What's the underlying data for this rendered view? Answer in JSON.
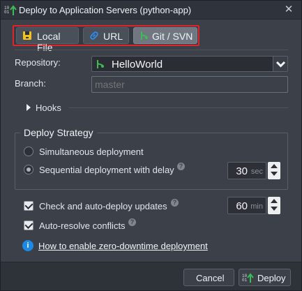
{
  "window": {
    "title": "Deploy to Application Servers (python-app)",
    "close_icon": "close-icon"
  },
  "tabs": [
    {
      "label": "Local File",
      "icon": "archive-icon",
      "active": false
    },
    {
      "label": "URL",
      "icon": "link-icon",
      "active": false
    },
    {
      "label": "Git / SVN",
      "icon": "git-icon",
      "active": true
    }
  ],
  "form": {
    "repository_label": "Repository:",
    "repository_value": "HelloWorld",
    "branch_label": "Branch:",
    "branch_placeholder": "master"
  },
  "hooks": {
    "label": "Hooks"
  },
  "strategy": {
    "legend": "Deploy Strategy",
    "option_simultaneous": "Simultaneous deployment",
    "option_sequential": "Sequential deployment with delay",
    "selected": "sequential",
    "delay_value": "30",
    "delay_unit": "sec"
  },
  "updates": {
    "auto_deploy_label": "Check and auto-deploy updates",
    "auto_deploy_checked": true,
    "interval_value": "60",
    "interval_unit": "min",
    "auto_resolve_label": "Auto-resolve conflicts",
    "auto_resolve_checked": true
  },
  "info": {
    "link_text": "How to enable zero-downtime deployment"
  },
  "footer": {
    "cancel_label": "Cancel",
    "deploy_label": "Deploy"
  },
  "colors": {
    "accent_highlight": "#e0242b",
    "git_green": "#3dbb55",
    "info_blue": "#1e88e5",
    "link_blue": "#2f8cf0",
    "archive_yellow": "#f4c21b"
  }
}
